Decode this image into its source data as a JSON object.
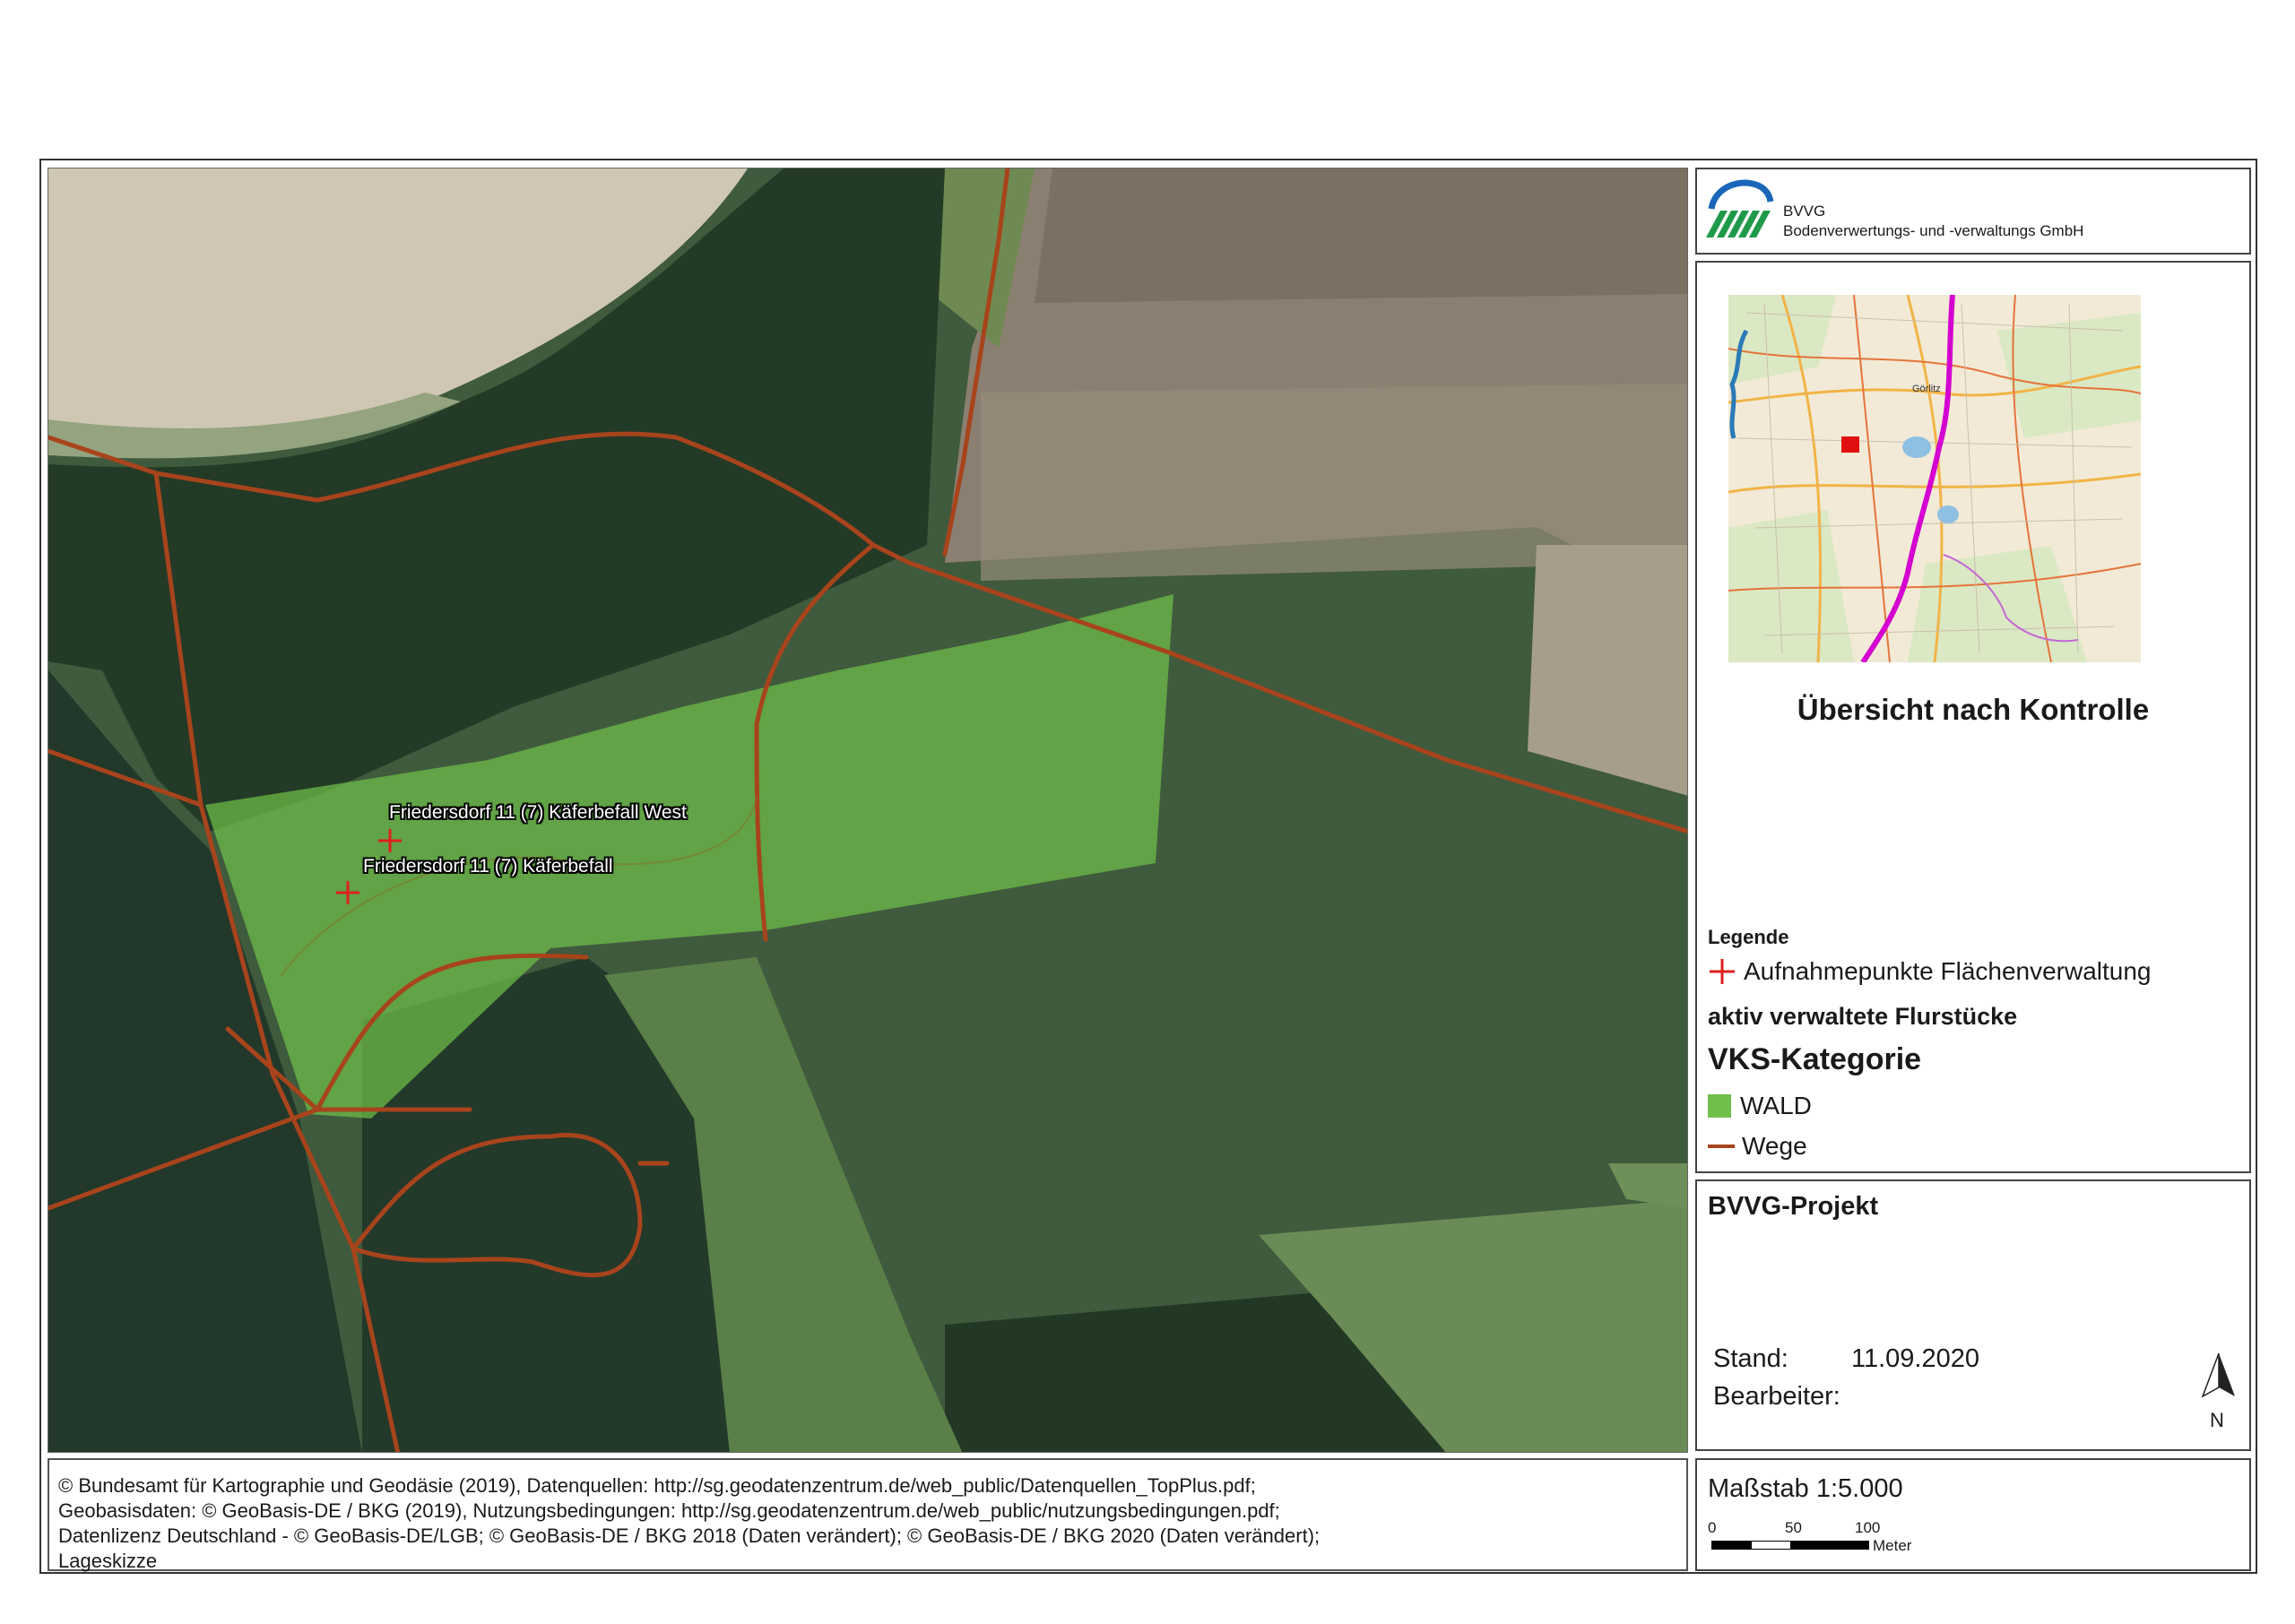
{
  "map": {
    "labels": [
      "Friedersdorf 11 (7) Käferbefall West",
      "Friedersdorf 11 (7) Käferbefall"
    ]
  },
  "copyright": {
    "lines": [
      "© Bundesamt für Kartographie und Geodäsie (2019), Datenquellen: http://sg.geodatenzentrum.de/web_public/Datenquellen_TopPlus.pdf;",
      "Geobasisdaten: © GeoBasis-DE / BKG (2019), Nutzungsbedingungen: http://sg.geodatenzentrum.de/web_public/nutzungsbedingungen.pdf;",
      "Datenlizenz Deutschland - © GeoBasis-DE/LGB;  © GeoBasis-DE / BKG 2018 (Daten verändert);  © GeoBasis-DE / BKG 2020 (Daten verändert);",
      "Lageskizze"
    ]
  },
  "logo": {
    "name": "BVVG",
    "subtitle": "Bodenverwertungs- und -verwaltungs GmbH"
  },
  "overview": {
    "title": "Übersicht nach Kontrolle",
    "place_label": "Görlitz"
  },
  "legend": {
    "heading": "Legende",
    "points_label": "Aufnahmepunkte Flächenverwaltung",
    "parcels_label": "aktiv verwaltete Flurstücke",
    "category_label": "VKS-Kategorie",
    "wald_label": "WALD",
    "wege_label": "Wege",
    "colors": {
      "wald": "#6fbf4a",
      "wege": "#a8441c",
      "points": "#e02020"
    }
  },
  "project": {
    "title": "BVVG-Projekt",
    "stand_label": "Stand:",
    "stand_value": "11.09.2020",
    "editor_label": "Bearbeiter:",
    "editor_value": "",
    "north_label": "N"
  },
  "scale": {
    "title": "Maßstab  1:5.000",
    "ticks": [
      "0",
      "50",
      "100"
    ],
    "unit": "Meter"
  }
}
